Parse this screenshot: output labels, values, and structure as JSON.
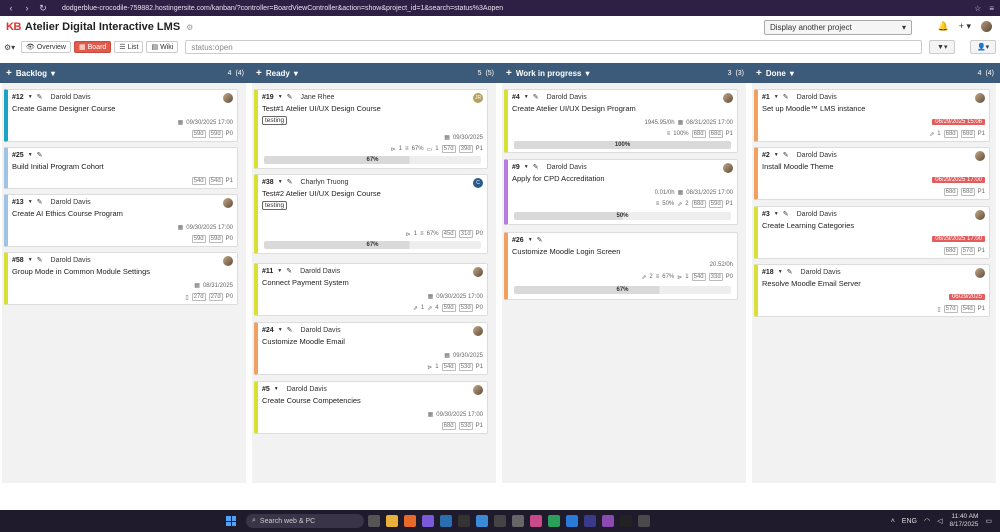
{
  "browser": {
    "url": "dodgerblue-crocodile-759882.hostingersite.com/kanban/?controller=BoardViewController&action=show&project_id=1&search=status%3Aopen"
  },
  "header": {
    "logo": "KB",
    "title": "Atelier Digital Interactive LMS",
    "project_select": "Display another project"
  },
  "viewbar": {
    "overview": "Overview",
    "board": "Board",
    "list": "List",
    "wiki": "Wiki",
    "search_value": "status:open"
  },
  "columns": [
    {
      "title": "Backlog",
      "count": "4",
      "total": "(4)"
    },
    {
      "title": "Ready",
      "count": "5",
      "total": "(5)"
    },
    {
      "title": "Work in progress",
      "count": "3",
      "total": "(3)"
    },
    {
      "title": "Done",
      "count": "4",
      "total": "(4)"
    }
  ],
  "cards": {
    "c12": {
      "num": "#12",
      "owner": "Darold Davis",
      "title": "Create Game Designer Course",
      "date": "09/30/2025 17:00",
      "b1": "59d",
      "b2": "59d",
      "prio": "P0"
    },
    "c25": {
      "num": "#25",
      "title": "Build Initial Program Cohort",
      "b1": "54d",
      "b2": "54d",
      "prio": "P1"
    },
    "c13": {
      "num": "#13",
      "owner": "Darold Davis",
      "title": "Create AI Ethics Course Program",
      "date": "09/30/2025 17:00",
      "b1": "59d",
      "b2": "59d",
      "prio": "P0"
    },
    "c58": {
      "num": "#58",
      "owner": "Darold Davis",
      "title": "Group Mode in Common Module Settings",
      "date": "08/31/2025",
      "b1": "27d",
      "b2": "27d",
      "prio": "P0"
    },
    "c19": {
      "num": "#19",
      "owner": "Jane Rhee",
      "title": "Test#1 Atelier UI/UX Design Course",
      "tag": "testing",
      "date": "09/30/2025",
      "m1": "1",
      "m2": "67%",
      "m3": "1",
      "b1": "57d",
      "b2": "39d",
      "prio": "P1",
      "progress": "67%",
      "avatar": "JR"
    },
    "c38": {
      "num": "#38",
      "owner": "Charlyn Truong",
      "title": "Test#2 Atelier UI/UX Design Course",
      "tag": "testing",
      "m1": "1",
      "m2": "67%",
      "b1": "45d",
      "b2": "31d",
      "prio": "P0",
      "progress": "67%",
      "avatar": "C"
    },
    "c11": {
      "num": "#11",
      "owner": "Darold Davis",
      "title": "Connect Payment System",
      "date": "09/30/2025 17:00",
      "m1": "1",
      "m2": "4",
      "b1": "59d",
      "b2": "53d",
      "prio": "P0"
    },
    "c24": {
      "num": "#24",
      "owner": "Darold Davis",
      "title": "Customize Moodle Email",
      "date": "09/30/2025",
      "m1": "1",
      "b1": "54d",
      "b2": "53d",
      "prio": "P1"
    },
    "c5": {
      "num": "#5",
      "owner": "Darold Davis",
      "title": "Create Course Competencies",
      "date": "09/30/2025 17:00",
      "b1": "68d",
      "b2": "53d",
      "prio": "P1"
    },
    "c4": {
      "num": "#4",
      "owner": "Darold Davis",
      "title": "Create Atelier UI/UX Design Program",
      "hours": "1945.95/0h",
      "date": "08/31/2025 17:00",
      "m2": "100%",
      "b1": "68d",
      "b2": "68d",
      "prio": "P1",
      "progress": "100%"
    },
    "c9": {
      "num": "#9",
      "owner": "Darold Davis",
      "title": "Apply for CPD Accreditation",
      "hours": "0.01/0h",
      "date": "08/31/2025 17:00",
      "m2": "50%",
      "m3": "2",
      "b1": "68d",
      "b2": "59d",
      "prio": "P1",
      "progress": "50%"
    },
    "c26": {
      "num": "#26",
      "title": "Customize Moodle Login Screen",
      "hours": "20.52/0h",
      "m1": "2",
      "m2": "67%",
      "m3": "1",
      "b1": "54d",
      "b2": "33d",
      "prio": "P0",
      "progress": "67%"
    },
    "c1": {
      "num": "#1",
      "owner": "Darold Davis",
      "title": "Set up Moodle™ LMS instance",
      "date": "06/29/2025 15:06",
      "m1": "1",
      "b1": "68d",
      "b2": "68d",
      "prio": "P1"
    },
    "c2": {
      "num": "#2",
      "owner": "Darold Davis",
      "title": "Install Moodle Theme",
      "date": "06/29/2025 17:00",
      "b1": "68d",
      "b2": "68d",
      "prio": "P1"
    },
    "c3": {
      "num": "#3",
      "owner": "Darold Davis",
      "title": "Create Learning Categories",
      "date": "06/29/2025 17:00",
      "b1": "68d",
      "b2": "57d",
      "prio": "P1"
    },
    "c18": {
      "num": "#18",
      "owner": "Darold Davis",
      "title": "Resolve Moodle Email Server",
      "date": "06/29/2025",
      "b1": "57d",
      "b2": "54d",
      "prio": "P1"
    }
  },
  "taskbar": {
    "search": "Search web & PC",
    "lang": "ENG",
    "time": "11:40 AM",
    "date": "8/17/2025"
  },
  "colors": {
    "header_bar": "#3c5a7a",
    "accent": "#e25a4a",
    "overdue": "#e35d5d"
  }
}
